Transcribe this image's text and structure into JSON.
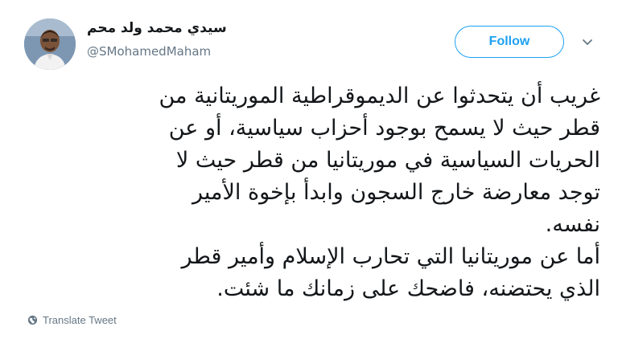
{
  "user": {
    "display_name": "سيدي محمد ولد محم",
    "handle": "@SMohamedMaham"
  },
  "actions": {
    "follow_label": "Follow",
    "menu_icon": "chevron-down-icon"
  },
  "tweet": {
    "lines": [
      "غريب أن يتحدثوا عن الديموقراطية الموريتانية من",
      "قطر حيث لا يسمح بوجود أحزاب سياسية، أو عن",
      "الحريات السياسية في موريتانيا من قطر حيث لا",
      "توجد معارضة خارج السجون وابدأ بإخوة الأمير",
      "نفسه.",
      "أما عن موريتانيا التي تحارب الإسلام وأمير قطر",
      "الذي يحتضنه، فاضحك على زمانك ما شئت."
    ]
  },
  "footer": {
    "translate_label": "Translate Tweet",
    "translate_icon": "globe-icon"
  },
  "colors": {
    "accent": "#1da1f2",
    "secondary_text": "#657786",
    "primary_text": "#14171a"
  }
}
